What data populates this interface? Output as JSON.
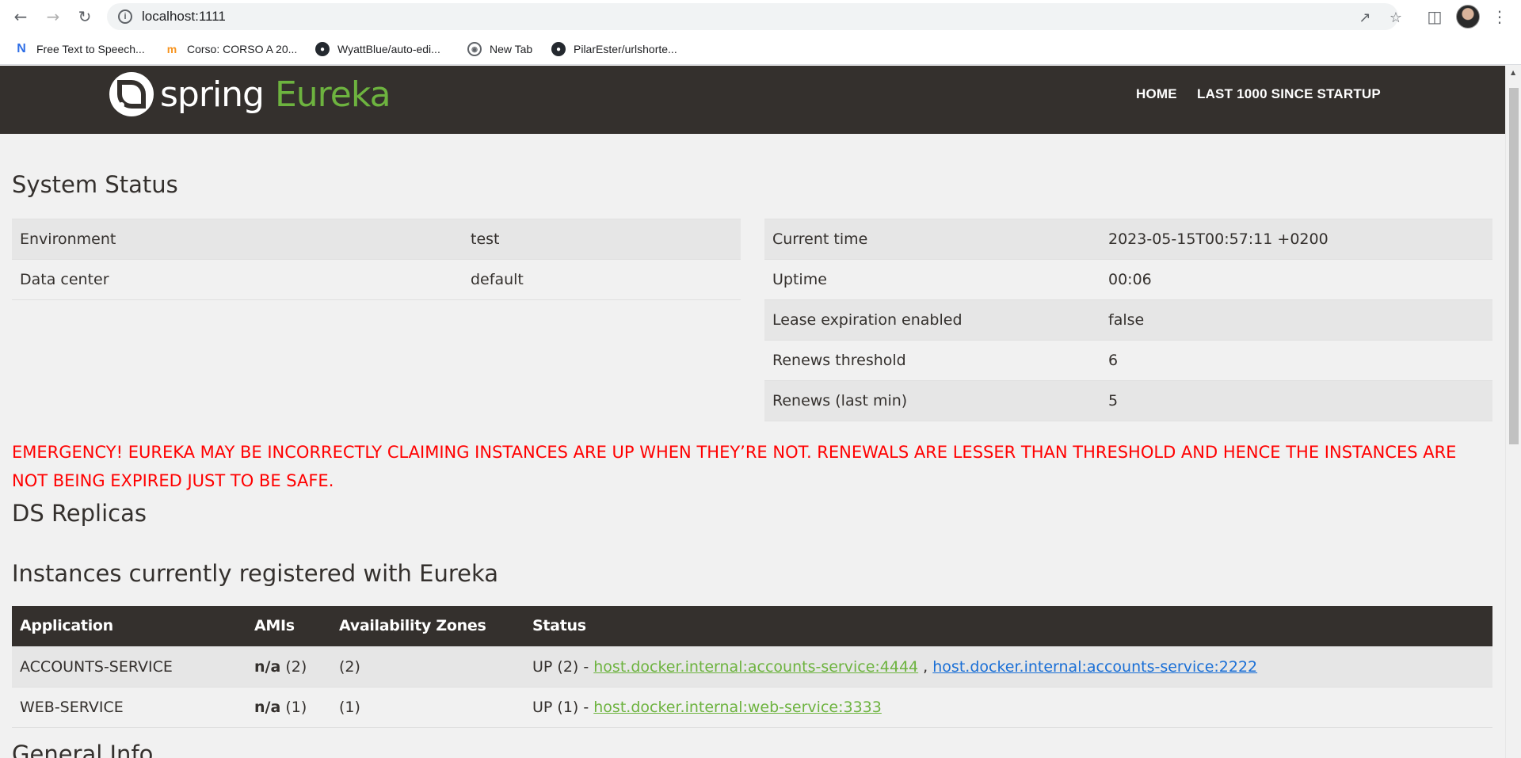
{
  "browser": {
    "url": "localhost:1111",
    "bookmarks": [
      {
        "label": "Free Text to Speech...",
        "icon": "n-icon"
      },
      {
        "label": "Corso: CORSO A 20...",
        "icon": "moodle-icon"
      },
      {
        "label": "WyattBlue/auto-edi...",
        "icon": "github-icon"
      },
      {
        "label": "New Tab",
        "icon": "globe-icon"
      },
      {
        "label": "PilarEster/urlshorte...",
        "icon": "github-icon"
      }
    ]
  },
  "header": {
    "logo_spring": "spring",
    "logo_eureka": "Eureka",
    "nav": [
      "HOME",
      "LAST 1000 SINCE STARTUP"
    ]
  },
  "system_status": {
    "title": "System Status",
    "left": [
      {
        "label": "Environment",
        "value": "test"
      },
      {
        "label": "Data center",
        "value": "default"
      }
    ],
    "right": [
      {
        "label": "Current time",
        "value": "2023-05-15T00:57:11 +0200"
      },
      {
        "label": "Uptime",
        "value": "00:06"
      },
      {
        "label": "Lease expiration enabled",
        "value": "false"
      },
      {
        "label": "Renews threshold",
        "value": "6"
      },
      {
        "label": "Renews (last min)",
        "value": "5"
      }
    ]
  },
  "emergency": "EMERGENCY! EUREKA MAY BE INCORRECTLY CLAIMING INSTANCES ARE UP WHEN THEY’RE NOT. RENEWALS ARE LESSER THAN THRESHOLD AND HENCE THE INSTANCES ARE NOT BEING EXPIRED JUST TO BE SAFE.",
  "ds_replicas": {
    "title": "DS Replicas"
  },
  "instances": {
    "title": "Instances currently registered with Eureka",
    "columns": [
      "Application",
      "AMIs",
      "Availability Zones",
      "Status"
    ],
    "rows": [
      {
        "application": "ACCOUNTS-SERVICE",
        "amis_bold": "n/a",
        "amis_count": "(2)",
        "zones": "(2)",
        "status_prefix": "UP (2) - ",
        "links": [
          "host.docker.internal:accounts-service:4444",
          "host.docker.internal:accounts-service:2222"
        ],
        "separator": " , "
      },
      {
        "application": "WEB-SERVICE",
        "amis_bold": "n/a",
        "amis_count": "(1)",
        "zones": "(1)",
        "status_prefix": "UP (1) - ",
        "links": [
          "host.docker.internal:web-service:3333"
        ]
      }
    ]
  },
  "general_info": {
    "title": "General Info"
  },
  "colors": {
    "header_bg": "#34302d",
    "brand_green": "#6db33f",
    "emergency_red": "#ff0000",
    "link_blue": "#1a6fd6"
  }
}
